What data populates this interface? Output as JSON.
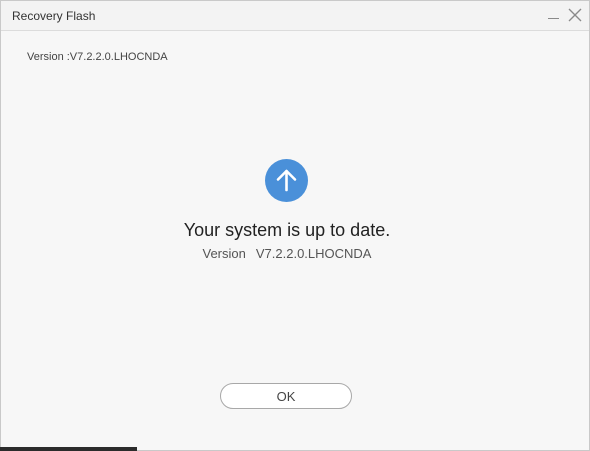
{
  "window": {
    "title": "Recovery Flash"
  },
  "version_info": {
    "top_label": "Version :V7.2.2.0.LHOCNDA"
  },
  "status": {
    "icon": "arrow-up-icon",
    "icon_color": "#4a90d9",
    "headline": "Your system is up to date.",
    "version_label": "Version",
    "version_value": "V7.2.2.0.LHOCNDA"
  },
  "actions": {
    "ok_label": "OK"
  }
}
